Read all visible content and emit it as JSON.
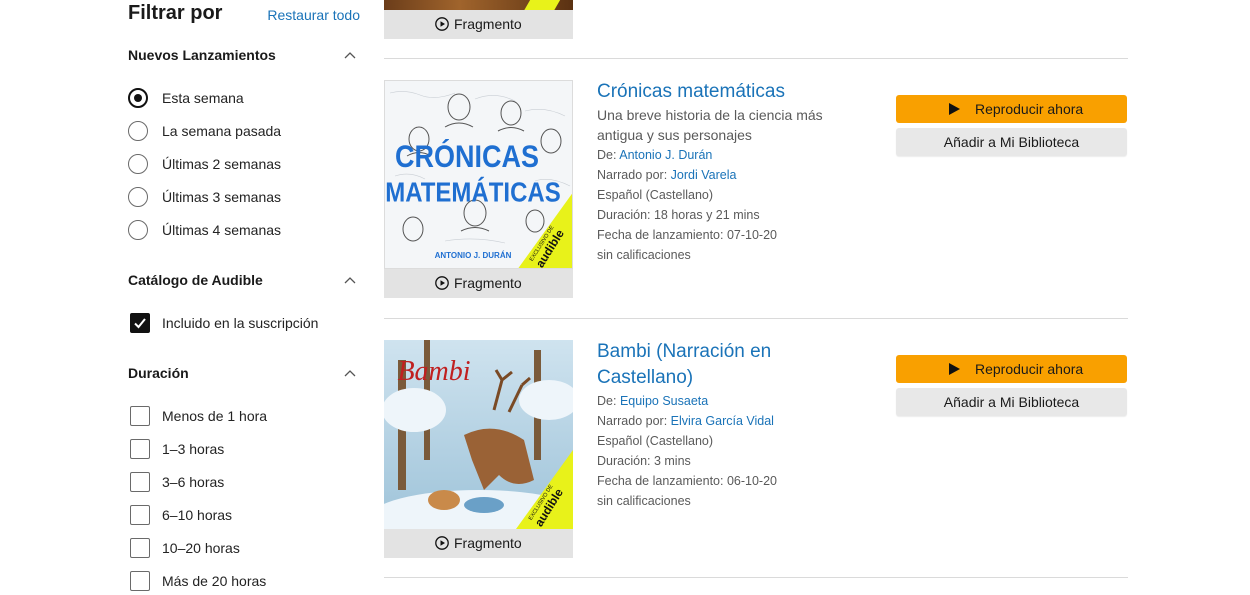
{
  "filters": {
    "title": "Filtrar por",
    "reset": "Restaurar todo",
    "new_releases": {
      "title": "Nuevos Lanzamientos",
      "options": [
        "Esta semana",
        "La semana pasada",
        "Últimas 2 semanas",
        "Últimas 3 semanas",
        "Últimas 4 semanas"
      ],
      "selected": "Esta semana"
    },
    "catalog": {
      "title": "Catálogo de Audible",
      "options": [
        "Incluido en la suscripción"
      ],
      "checked": [
        "Incluido en la suscripción"
      ]
    },
    "duration": {
      "title": "Duración",
      "options": [
        "Menos de 1 hora",
        "1–3 horas",
        "3–6 horas",
        "6–10 horas",
        "10–20 horas",
        "Más de 20 horas"
      ]
    }
  },
  "results": {
    "fragment_label": "Fragmento",
    "play_label": "Reproducir ahora",
    "library_label": "Añadir a Mi Biblioteca",
    "items": [
      {
        "title": "Crónicas matemáticas",
        "subtitle": "Una breve historia de la ciencia más antigua y sus personajes",
        "author_prefix": "De:",
        "author": "Antonio J. Durán",
        "narrator_prefix": "Narrado por:",
        "narrator": "Jordi Varela",
        "language": "Español (Castellano)",
        "duration": "Duración: 18 horas y 21 mins",
        "release": "Fecha de lanzamiento: 07-10-20",
        "rating": "sin calificaciones",
        "cover": {
          "title_line1": "CRÓNICAS",
          "title_line2": "MATEMÁTICAS",
          "author": "ANTONIO J. DURÁN",
          "badge_small": "EXCLUSIVO DE",
          "badge_brand": "audible"
        }
      },
      {
        "title": "Bambi (Narración en Castellano)",
        "subtitle": "",
        "author_prefix": "De:",
        "author": "Equipo Susaeta",
        "narrator_prefix": "Narrado por:",
        "narrator": "Elvira García Vidal",
        "language": "Español (Castellano)",
        "duration": "Duración: 3 mins",
        "release": "Fecha de lanzamiento: 06-10-20",
        "rating": "sin calificaciones",
        "cover": {
          "title": "Bambi",
          "badge_small": "EXCLUSIVO DE",
          "badge_brand": "audible"
        }
      }
    ]
  },
  "colors": {
    "accent": "#f9a000",
    "link": "#1a73b8",
    "badge": "#e8f21a"
  }
}
